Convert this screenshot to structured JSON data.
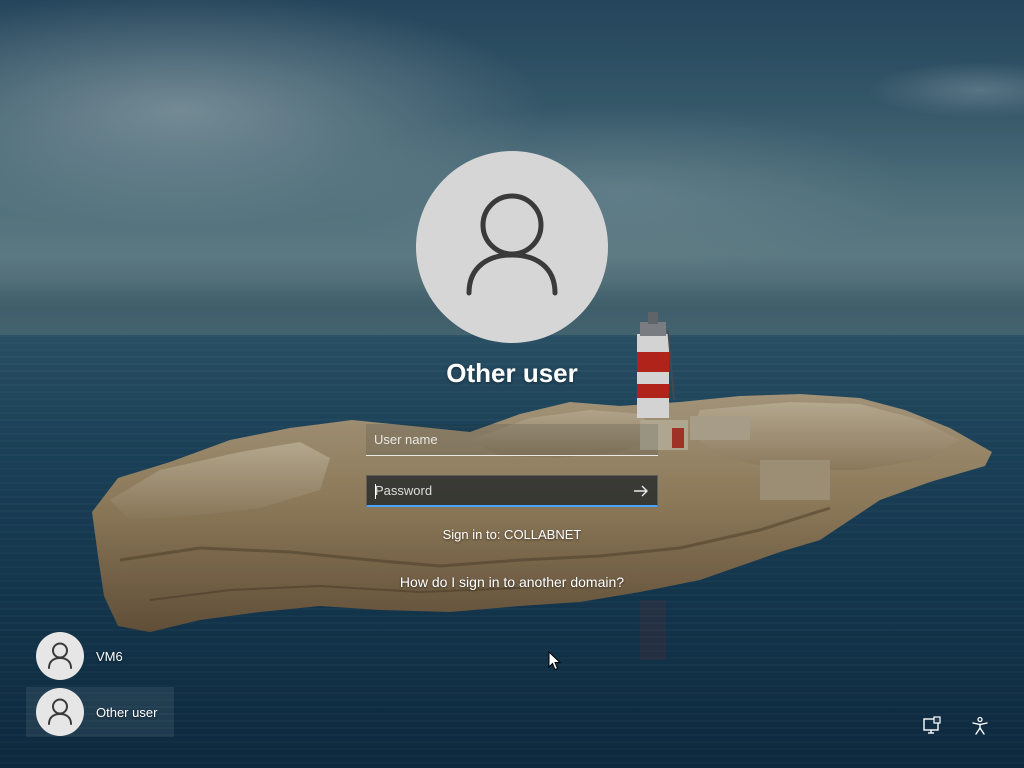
{
  "login": {
    "title": "Other user",
    "username_placeholder": "User name",
    "password_placeholder": "Password",
    "sign_in_to": "Sign in to: COLLABNET",
    "help_link": "How do I sign in to another domain?"
  },
  "users": [
    {
      "label": "VM6",
      "icon": "user-icon",
      "selected": false
    },
    {
      "label": "Other user",
      "icon": "user-icon",
      "selected": true
    }
  ],
  "corner_icons": [
    {
      "icon": "network-icon"
    },
    {
      "icon": "accessibility-icon"
    }
  ],
  "colors": {
    "accent": "#4aa3ff",
    "avatar_bg": "#d6d6d6",
    "text": "#ffffff"
  }
}
